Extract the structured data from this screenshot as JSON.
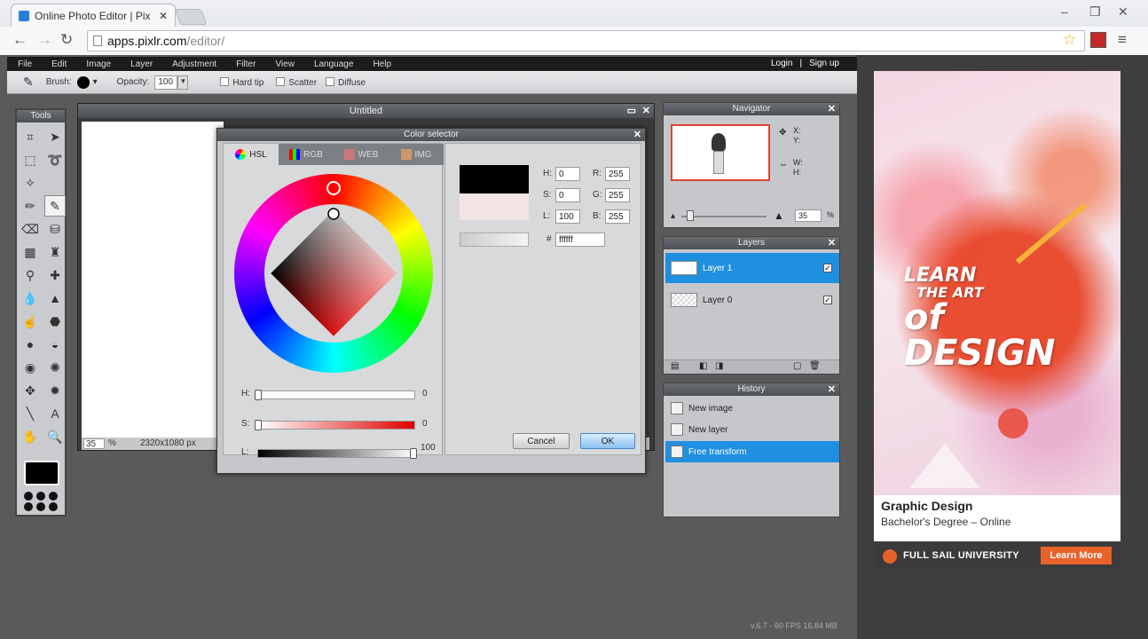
{
  "browser": {
    "tab_title": "Online Photo Editor | Pix",
    "url_host": "apps.pixlr.com",
    "url_path": "/editor/"
  },
  "menu": {
    "items": [
      "File",
      "Edit",
      "Image",
      "Layer",
      "Adjustment",
      "Filter",
      "View",
      "Language",
      "Help"
    ],
    "login": "Login",
    "separator": "|",
    "signup": "Sign up"
  },
  "options": {
    "brush_label": "Brush:",
    "opacity_label": "Opacity:",
    "opacity_value": "100",
    "hard_tip": "Hard tip",
    "scatter": "Scatter",
    "diffuse": "Diffuse"
  },
  "tools_panel": {
    "title": "Tools"
  },
  "document": {
    "title": "Untitled",
    "zoom": "35",
    "zoom_unit": "%",
    "size": "2320x1080 px"
  },
  "color_selector": {
    "title": "Color selector",
    "tabs": [
      "HSL",
      "RGB",
      "WEB",
      "IMG"
    ],
    "h_label": "H:",
    "h_value": "0",
    "s_label": "S:",
    "s_value": "0",
    "l_label": "L:",
    "l_value": "100",
    "r_label": "R:",
    "r_value": "255",
    "g_label": "G:",
    "g_value": "255",
    "b_label": "B:",
    "b_value": "255",
    "hash_label": "#",
    "hex_value": "ffffff",
    "slider_h_label": "H:",
    "slider_h_value": "0",
    "slider_s_label": "S:",
    "slider_s_value": "0",
    "slider_l_label": "L:",
    "slider_l_value": "100",
    "cancel": "Cancel",
    "ok": "OK",
    "old_color": "#000000",
    "new_color": "#f3e5e5"
  },
  "navigator": {
    "title": "Navigator",
    "x_label": "X:",
    "y_label": "Y:",
    "w_label": "W:",
    "h_label": "H:",
    "zoom_value": "35",
    "zoom_unit": "%"
  },
  "layers": {
    "title": "Layers",
    "items": [
      {
        "name": "Layer 1",
        "selected": true
      },
      {
        "name": "Layer 0",
        "selected": false
      }
    ]
  },
  "history": {
    "title": "History",
    "items": [
      {
        "name": "New image",
        "selected": false
      },
      {
        "name": "New layer",
        "selected": false
      },
      {
        "name": "Free transform",
        "selected": true
      }
    ]
  },
  "status": {
    "fps_text": "v.6.7 - 60 FPS 16.84 MB"
  },
  "ad": {
    "headline_1": "LEARN",
    "headline_2": "THE ART",
    "headline_3": "of DESIGN",
    "title": "Graphic Design",
    "subtitle": "Bachelor's Degree – Online",
    "university": "FULL SAIL UNIVERSITY",
    "cta": "Learn More"
  },
  "colors": {
    "selection_blue": "#1f8fe0",
    "ad_orange": "#e8622a"
  }
}
